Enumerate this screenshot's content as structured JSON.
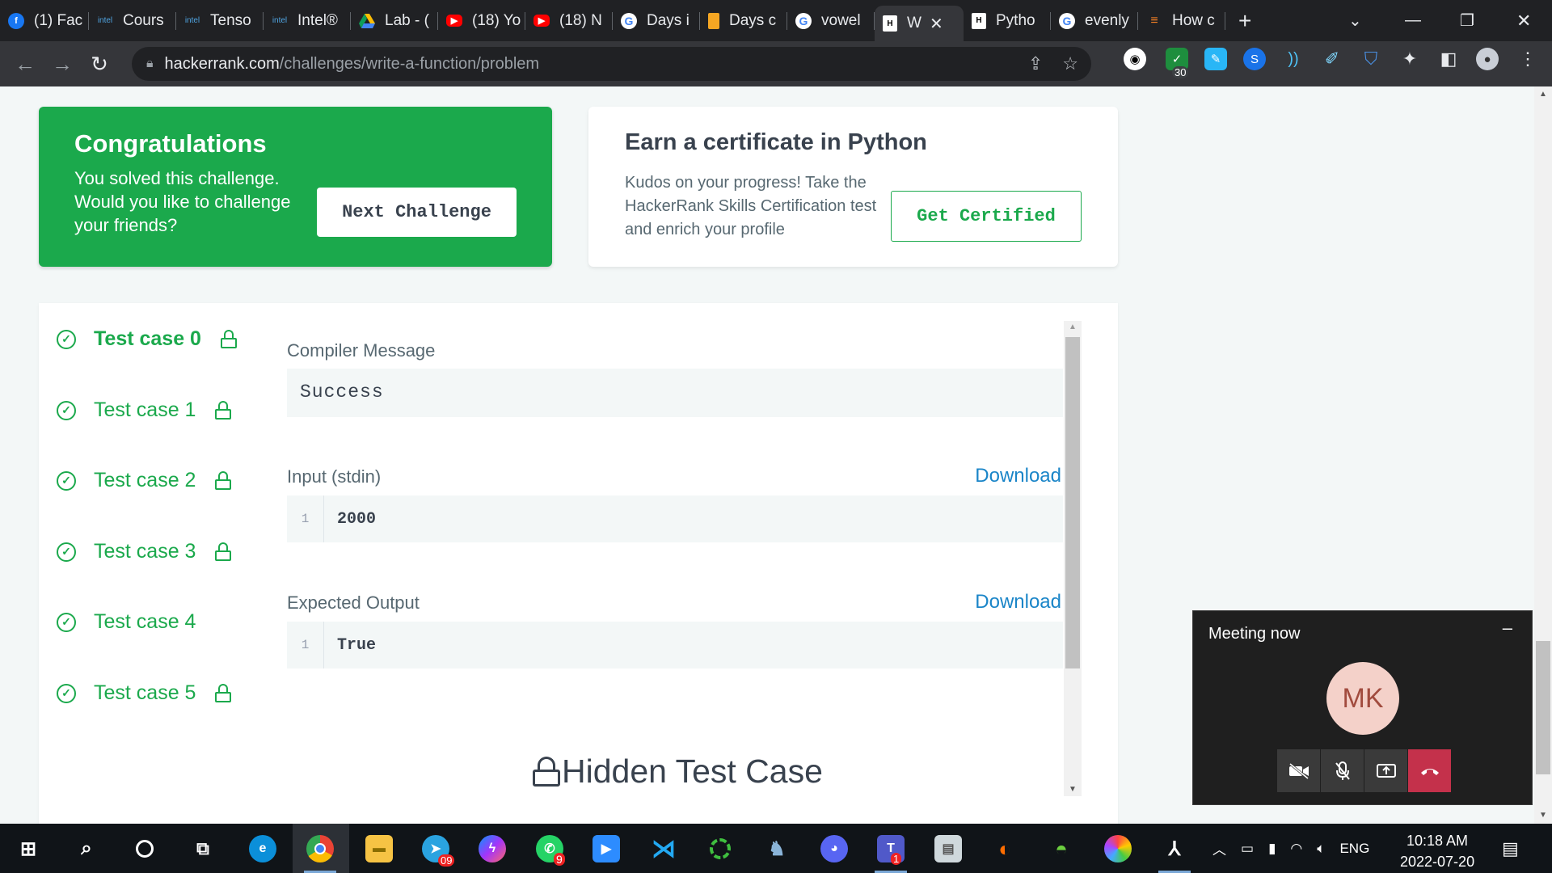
{
  "browser": {
    "tabs": [
      {
        "label": "(1) Fac",
        "icon": "facebook-icon"
      },
      {
        "label": "Cours",
        "icon": "intel-icon"
      },
      {
        "label": "Tenso",
        "icon": "intel-icon"
      },
      {
        "label": "Intel®",
        "icon": "intel-icon"
      },
      {
        "label": "Lab - (",
        "icon": "google-drive-icon"
      },
      {
        "label": "(18) Yo",
        "icon": "youtube-icon"
      },
      {
        "label": "(18) N",
        "icon": "youtube-icon"
      },
      {
        "label": "Days i",
        "icon": "google-icon"
      },
      {
        "label": "Days c",
        "icon": "bookmark-icon"
      },
      {
        "label": "vowel",
        "icon": "google-icon"
      },
      {
        "label": "W",
        "icon": "hackerrank-icon",
        "active": true
      },
      {
        "label": "Pytho",
        "icon": "hackerrank-icon"
      },
      {
        "label": "evenly",
        "icon": "google-icon"
      },
      {
        "label": "How c",
        "icon": "stackoverflow-icon"
      }
    ],
    "new_tab": "+",
    "url_domain": "hackerrank.com",
    "url_path": "/challenges/write-a-function/problem",
    "ext_badge": "30"
  },
  "congrats": {
    "title": "Congratulations",
    "message": "You solved this challenge. Would you like to challenge your friends?",
    "button": "Next Challenge"
  },
  "certificate": {
    "title": "Earn a certificate in Python",
    "message": "Kudos on your progress! Take the HackerRank Skills Certification test and enrich your profile",
    "button": "Get Certified"
  },
  "test_cases": [
    {
      "label": "Test case 0",
      "active": true
    },
    {
      "label": "Test case 1"
    },
    {
      "label": "Test case 2"
    },
    {
      "label": "Test case 3"
    },
    {
      "label": "Test case 4"
    },
    {
      "label": "Test case 5"
    }
  ],
  "result": {
    "compiler_label": "Compiler Message",
    "compiler_value": "Success",
    "input_label": "Input (stdin)",
    "input_line_no": "1",
    "input_value": "2000",
    "output_label": "Expected Output",
    "output_line_no": "1",
    "output_value": "True",
    "download": "Download",
    "hidden_label": "Hidden Test Case"
  },
  "meeting": {
    "title": "Meeting now",
    "minimize": "–",
    "initials": "MK"
  },
  "taskbar": {
    "language": "ENG",
    "time": "10:18 AM",
    "date": "2022-07-20",
    "telegram_badge": "09",
    "whatsapp_badge": "9",
    "teams_badge": "1"
  },
  "colors": {
    "brand_green": "#1ba94c",
    "link_blue": "#1a85c8",
    "end_call_red": "#c4314b"
  }
}
